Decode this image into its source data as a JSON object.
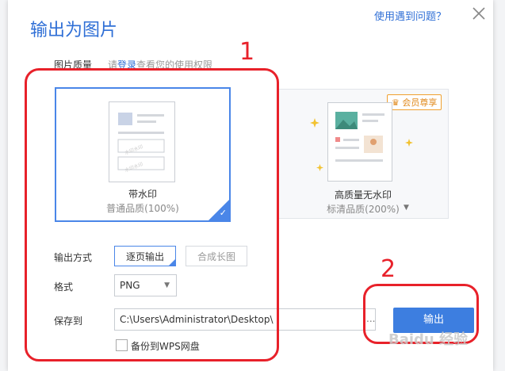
{
  "dialog": {
    "title": "输出为图片",
    "help_link": "使用遇到问题？",
    "quality_label": "图片质量",
    "login_prefix": "请",
    "login_link": "登录",
    "login_suffix": "查看您的使用权限"
  },
  "options": {
    "watermark": {
      "title": "带水印",
      "subtitle": "普通品质(100%)"
    },
    "hq": {
      "badge": "会员尊享",
      "title": "高质量无水印",
      "subtitle": "标清品质(200%)"
    }
  },
  "output_mode": {
    "label": "输出方式",
    "buttons": [
      "逐页输出",
      "合成长图"
    ]
  },
  "format": {
    "label": "格式",
    "value": "PNG"
  },
  "save": {
    "label": "保存到",
    "path": "C:\\Users\\Administrator\\Desktop\\",
    "browse": "..."
  },
  "backup": {
    "label": "备份到WPS网盘"
  },
  "export_button": "输出",
  "annotations": {
    "n1": "1",
    "n2": "2"
  },
  "watermark_text": "Baidu 经验",
  "colors": {
    "accent": "#3d7ee0",
    "annotation": "#e8212a"
  }
}
